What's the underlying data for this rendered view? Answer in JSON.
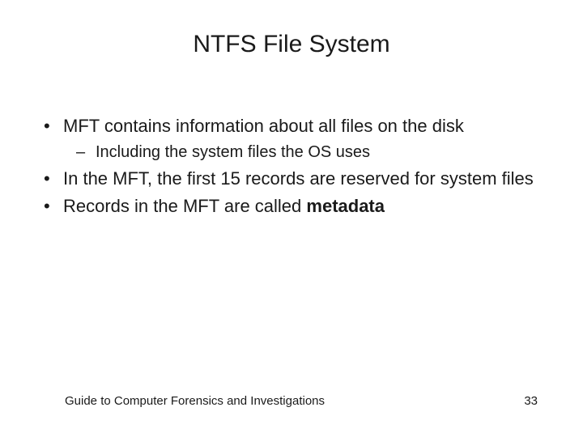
{
  "title": "NTFS File System",
  "bullets": {
    "b1": "MFT contains information about all files on the disk",
    "b1a": "Including the system files the OS uses",
    "b2": "In the MFT, the first 15 records are reserved for system files",
    "b3_prefix": "Records in the MFT are called ",
    "b3_bold": "metadata"
  },
  "footer": {
    "text": "Guide to Computer Forensics and Investigations",
    "page": "33"
  }
}
